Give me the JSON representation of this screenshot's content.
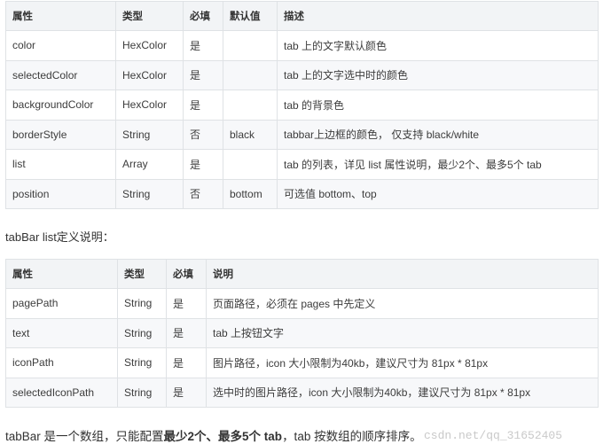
{
  "table1": {
    "headers": [
      "属性",
      "类型",
      "必填",
      "默认值",
      "描述"
    ],
    "rows": [
      [
        "color",
        "HexColor",
        "是",
        "",
        "tab 上的文字默认颜色"
      ],
      [
        "selectedColor",
        "HexColor",
        "是",
        "",
        "tab 上的文字选中时的颜色"
      ],
      [
        "backgroundColor",
        "HexColor",
        "是",
        "",
        "tab 的背景色"
      ],
      [
        "borderStyle",
        "String",
        "否",
        "black",
        "tabbar上边框的颜色， 仅支持 black/white"
      ],
      [
        "list",
        "Array",
        "是",
        "",
        "tab 的列表，详见 list 属性说明，最少2个、最多5个 tab"
      ],
      [
        "position",
        "String",
        "否",
        "bottom",
        "可选值 bottom、top"
      ]
    ]
  },
  "caption": "tabBar list定义说明：",
  "table2": {
    "headers": [
      "属性",
      "类型",
      "必填",
      "说明"
    ],
    "rows": [
      [
        "pagePath",
        "String",
        "是",
        "页面路径，必须在 pages 中先定义"
      ],
      [
        "text",
        "String",
        "是",
        "tab 上按钮文字"
      ],
      [
        "iconPath",
        "String",
        "是",
        "图片路径，icon 大小限制为40kb，建议尺寸为 81px * 81px"
      ],
      [
        "selectedIconPath",
        "String",
        "是",
        "选中时的图片路径，icon 大小限制为40kb，建议尺寸为 81px * 81px"
      ]
    ]
  },
  "footer": {
    "part1": "tabBar 是一个数组，只能配置",
    "bold": "最少2个、最多5个 tab",
    "part2": "，tab 按数组的顺序排序。"
  },
  "watermark": "csdn.net/qq_31652405"
}
